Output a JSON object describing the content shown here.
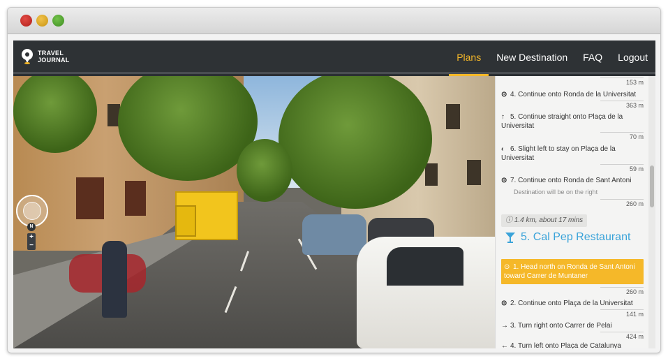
{
  "app": {
    "logo_line1": "TRAVEL",
    "logo_line2": "JOURNAL"
  },
  "nav": {
    "items": [
      {
        "label": "Plans",
        "active": true
      },
      {
        "label": "New Destination",
        "active": false
      },
      {
        "label": "FAQ",
        "active": false
      },
      {
        "label": "Logout",
        "active": false
      }
    ]
  },
  "streetview": {
    "compass_north": "N",
    "zoom_in": "+",
    "zoom_out": "−"
  },
  "directions": {
    "top_distance": "153 m",
    "steps_before": [
      {
        "icon": "target-icon",
        "glyph": "⊙",
        "text": "4. Continue onto Ronda de la Universitat",
        "distance": "363 m"
      },
      {
        "icon": "arrow-up-icon",
        "glyph": "↑",
        "text": "5. Continue straight onto Plaça de la Universitat",
        "distance": "70 m"
      },
      {
        "icon": "chevron-left-icon",
        "glyph": "‹",
        "text": "6. Slight left to stay on Plaça de la Universitat",
        "distance": "59 m"
      },
      {
        "icon": "target-icon",
        "glyph": "⊙",
        "text": "7. Continue onto Ronda de Sant Antoni",
        "sub": "Destination will be on the right",
        "distance": "260 m"
      }
    ],
    "summary": "1.4 km, about 17 mins",
    "destination_title": "5. Cal Pep Restaurant",
    "steps_after": [
      {
        "icon": "target-icon",
        "glyph": "⊙",
        "text": "1. Head north on Ronda de Sant Antoni toward Carrer de Muntaner",
        "distance": "260 m",
        "highlight": true
      },
      {
        "icon": "target-icon",
        "glyph": "⊙",
        "text": "2. Continue onto Plaça de la Universitat",
        "distance": "141 m"
      },
      {
        "icon": "arrow-right-icon",
        "glyph": "→",
        "text": "3. Turn right onto Carrer de Pelai",
        "distance": "424 m"
      },
      {
        "icon": "arrow-left-icon",
        "glyph": "←",
        "text": "4. Turn left onto Plaça de Catalunya"
      }
    ]
  },
  "colors": {
    "accent": "#f5b829",
    "link": "#3aa3d9",
    "navbar": "#2e3235"
  }
}
